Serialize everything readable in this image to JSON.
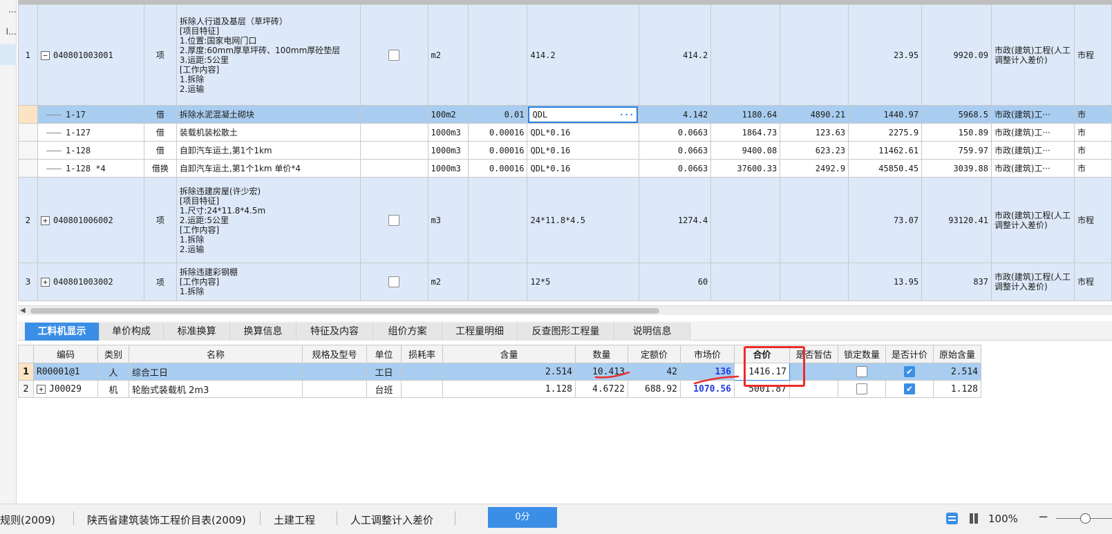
{
  "left_strip": {
    "items": [
      "…",
      "l…"
    ]
  },
  "upper": {
    "rows": [
      {
        "kind": "bill",
        "rownum": "1",
        "expander": "−",
        "code": "040801003001",
        "type": "项",
        "name": "拆除人行道及基层（草坪砖）\n[项目特征]\n1.位置:国家电网门口\n2.厚度:60mm厚草坪砖、100mm厚砼垫层\n3.运距:5公里\n[工作内容]\n1.拆除\n2.运输",
        "unit": "m2",
        "qty_coef": "",
        "formula": "414.2",
        "quantity": "414.2",
        "unit_price": "",
        "labor": "",
        "combined_price": "23.95",
        "total": "9920.09",
        "category": "市政(建筑)工程(人工调整计入差价)",
        "extra": "市程"
      },
      {
        "kind": "sub-sel",
        "rownum": "",
        "code": "1-17",
        "type": "借",
        "name": "拆除水泥混凝土砌块",
        "unit": "100m2",
        "qty_coef": "0.01",
        "formula": "QDL",
        "formula_btn": "···",
        "quantity": "4.142",
        "unit_price": "1180.64",
        "labor": "4890.21",
        "combined_price": "1440.97",
        "total": "5968.5",
        "category": "市政(建筑)工···",
        "extra": "市"
      },
      {
        "kind": "sub",
        "rownum": "",
        "code": "1-127",
        "type": "借",
        "name": "装载机装松散土",
        "unit": "1000m3",
        "qty_coef": "0.00016",
        "formula": "QDL*0.16",
        "quantity": "0.0663",
        "unit_price": "1864.73",
        "labor": "123.63",
        "combined_price": "2275.9",
        "total": "150.89",
        "category": "市政(建筑)工···",
        "extra": "市"
      },
      {
        "kind": "sub",
        "rownum": "",
        "code": "1-128",
        "type": "借",
        "name": "自卸汽车运土,第1个1km",
        "unit": "1000m3",
        "qty_coef": "0.00016",
        "formula": "QDL*0.16",
        "quantity": "0.0663",
        "unit_price": "9400.08",
        "labor": "623.23",
        "combined_price": "11462.61",
        "total": "759.97",
        "category": "市政(建筑)工···",
        "extra": "市"
      },
      {
        "kind": "sub",
        "rownum": "",
        "code": "1-128 *4",
        "type": "借换",
        "name": "自卸汽车运土,第1个1km  单价*4",
        "unit": "1000m3",
        "qty_coef": "0.00016",
        "formula": "QDL*0.16",
        "quantity": "0.0663",
        "unit_price": "37600.33",
        "labor": "2492.9",
        "combined_price": "45850.45",
        "total": "3039.88",
        "category": "市政(建筑)工···",
        "extra": "市"
      },
      {
        "kind": "bill",
        "rownum": "2",
        "expander": "+",
        "code": "040801006002",
        "type": "项",
        "name": "拆除违建房屋(许少宏)\n[项目特征]\n1.尺寸:24*11.8*4.5m\n2.运距:5公里\n[工作内容]\n1.拆除\n2.运输",
        "unit": "m3",
        "qty_coef": "",
        "formula": "24*11.8*4.5",
        "quantity": "1274.4",
        "unit_price": "",
        "labor": "",
        "combined_price": "73.07",
        "total": "93120.41",
        "category": "市政(建筑)工程(人工调整计入差价)",
        "extra": "市程"
      },
      {
        "kind": "bill",
        "rownum": "3",
        "expander": "+",
        "code": "040801003002",
        "type": "项",
        "name": "拆除违建彩钢棚\n[工作内容]\n1.拆除",
        "unit": "m2",
        "qty_coef": "",
        "formula": "12*5",
        "quantity": "60",
        "unit_price": "",
        "labor": "",
        "combined_price": "13.95",
        "total": "837",
        "category": "市政(建筑)工程(人工调整计入差价)",
        "extra": "市程"
      }
    ]
  },
  "tabs": [
    "工料机显示",
    "单价构成",
    "标准换算",
    "换算信息",
    "特征及内容",
    "组价方案",
    "工程量明细",
    "反查图形工程量",
    "说明信息"
  ],
  "lower": {
    "headers": [
      "",
      "编码",
      "类别",
      "名称",
      "规格及型号",
      "单位",
      "损耗率",
      "含量",
      "数量",
      "定额价",
      "市场价",
      "合价",
      "是否暂估",
      "锁定数量",
      "是否计价",
      "原始含量"
    ],
    "rows": [
      {
        "rownum": "1",
        "expander": "",
        "code": "R00001@1",
        "category": "人",
        "name": "综合工日",
        "spec": "",
        "unit": "工日",
        "loss": "",
        "content": "2.514",
        "qty": "10.413",
        "base_price": "42",
        "market_price": "136",
        "total": "1416.17",
        "provisional": "",
        "lock_qty": false,
        "priced": true,
        "original_content": "2.514"
      },
      {
        "rownum": "2",
        "expander": "+",
        "code": "J00029",
        "category": "机",
        "name": "轮胎式装载机 2m3",
        "spec": "",
        "unit": "台班",
        "loss": "",
        "content": "1.128",
        "qty": "4.6722",
        "base_price": "688.92",
        "market_price": "1070.56",
        "total": "5001.87",
        "provisional": "",
        "lock_qty": false,
        "priced": true,
        "original_content": "1.128"
      }
    ]
  },
  "status_bar": {
    "items": [
      "规则(2009)",
      "陕西省建筑装饰工程价目表(2009)",
      "土建工程",
      "人工调整计入差价"
    ],
    "progress_label": "0分",
    "zoom": "100%",
    "zoom_minus": "−"
  },
  "colors": {
    "accent": "#3a8ee6",
    "selection": "#a9cdf0",
    "bill_row": "#dde9f8",
    "annotation": "#ee2a2a",
    "market_price_text": "#1f3ae0"
  },
  "icons": {
    "expand": "plus-box-icon",
    "collapse": "minus-box-icon",
    "checkbox_checked": "check-icon",
    "list_view": "list-view-icon",
    "column_view": "column-view-icon"
  }
}
